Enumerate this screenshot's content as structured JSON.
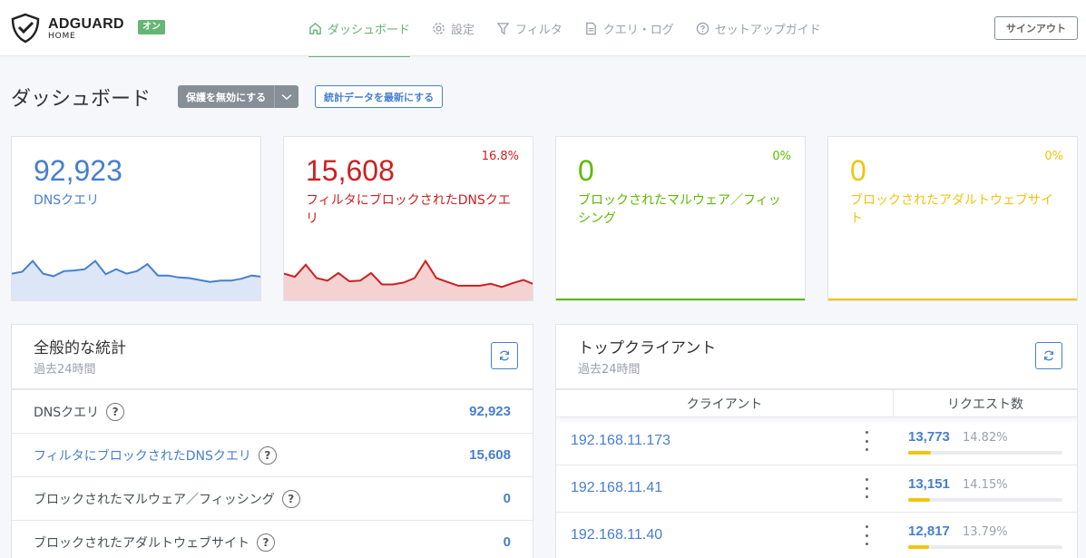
{
  "header": {
    "brand_name": "ADGUARD",
    "brand_sub": "HOME",
    "status_badge": "オン",
    "nav": [
      {
        "label": "ダッシュボード",
        "icon": "home-icon",
        "active": true
      },
      {
        "label": "設定",
        "icon": "gear-icon",
        "active": false
      },
      {
        "label": "フィルタ",
        "icon": "filter-icon",
        "active": false
      },
      {
        "label": "クエリ・ログ",
        "icon": "document-icon",
        "active": false
      },
      {
        "label": "セットアップガイド",
        "icon": "help-circle-icon",
        "active": false
      }
    ],
    "signout_label": "サインアウト"
  },
  "page": {
    "title": "ダッシュボード",
    "disable_protection_label": "保護を無効にする",
    "refresh_stats_label": "統計データを最新にする"
  },
  "stat_cards": [
    {
      "value": "92,923",
      "label": "DNSクエリ",
      "percent": "",
      "color": "#467fcf",
      "fill": "#dce6f7",
      "trend": [
        0.42,
        0.45,
        0.62,
        0.42,
        0.38,
        0.46,
        0.47,
        0.49,
        0.62,
        0.41,
        0.49,
        0.42,
        0.46,
        0.57,
        0.39,
        0.39,
        0.36,
        0.35,
        0.32,
        0.29,
        0.31,
        0.31,
        0.34,
        0.39,
        0.37
      ]
    },
    {
      "value": "15,608",
      "label": "フィルタにブロックされたDNSクエリ",
      "percent": "16.8%",
      "color": "#cd201f",
      "fill": "#f5d2d2",
      "trend": [
        0.42,
        0.37,
        0.56,
        0.35,
        0.31,
        0.43,
        0.3,
        0.31,
        0.43,
        0.25,
        0.25,
        0.28,
        0.35,
        0.62,
        0.35,
        0.29,
        0.23,
        0.23,
        0.23,
        0.26,
        0.21,
        0.27,
        0.32,
        0.25
      ]
    },
    {
      "value": "0",
      "label": "ブロックされたマルウェア／フィッシング",
      "percent": "0%",
      "color": "#5eba00",
      "fill": "#ffffff",
      "trend": []
    },
    {
      "value": "0",
      "label": "ブロックされたアダルトウェブサイト",
      "percent": "0%",
      "color": "#f1c40f",
      "fill": "#ffffff",
      "trend": []
    }
  ],
  "general_stats": {
    "title": "全般的な統計",
    "subtitle": "過去24時間",
    "refresh_icon": "refresh-icon",
    "rows": [
      {
        "label": "DNSクエリ",
        "value": "92,923",
        "link": false
      },
      {
        "label": "フィルタにブロックされたDNSクエリ",
        "value": "15,608",
        "link": true
      },
      {
        "label": "ブロックされたマルウェア／フィッシング",
        "value": "0",
        "link": false
      },
      {
        "label": "ブロックされたアダルトウェブサイト",
        "value": "0",
        "link": false
      }
    ]
  },
  "top_clients": {
    "title": "トップクライアント",
    "subtitle": "過去24時間",
    "col_client": "クライアント",
    "col_requests": "リクエスト数",
    "rows": [
      {
        "ip": "192.168.11.173",
        "count": "13,773",
        "percent": "14.82%",
        "share": 0.1482
      },
      {
        "ip": "192.168.11.41",
        "count": "13,151",
        "percent": "14.15%",
        "share": 0.1415
      },
      {
        "ip": "192.168.11.40",
        "count": "12,817",
        "percent": "13.79%",
        "share": 0.1379
      }
    ]
  }
}
